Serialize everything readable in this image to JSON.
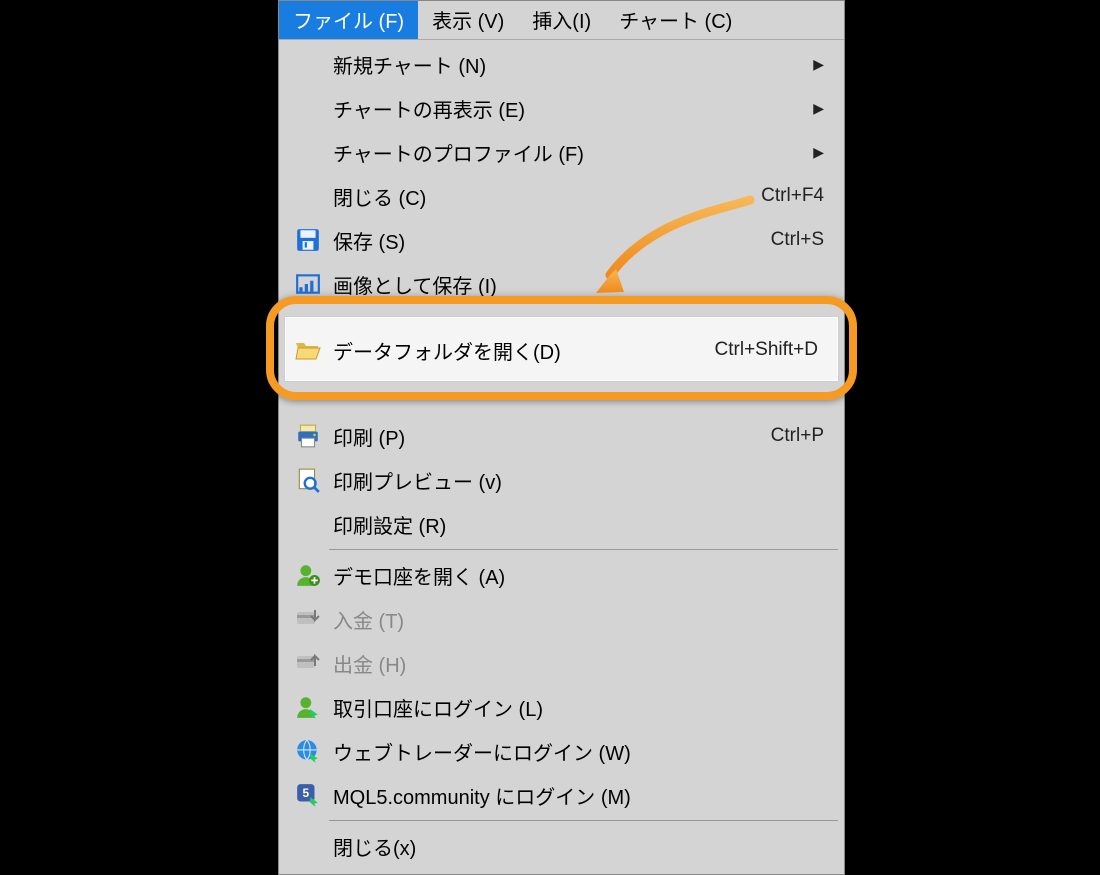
{
  "menubar": {
    "items": [
      {
        "label": "ファイル (F)"
      },
      {
        "label": "表示 (V)"
      },
      {
        "label": "挿入(I)"
      },
      {
        "label": "チャート (C)"
      }
    ]
  },
  "dropdown": {
    "new_chart": {
      "label": "新規チャート (N)"
    },
    "reshow_chart": {
      "label": "チャートの再表示 (E)"
    },
    "chart_profile": {
      "label": "チャートのプロファイル (F)"
    },
    "close": {
      "label": "閉じる (C)",
      "accel": "Ctrl+F4"
    },
    "save": {
      "label": "保存 (S)",
      "accel": "Ctrl+S"
    },
    "save_as_image": {
      "label": "画像として保存 (I)"
    },
    "open_data_folder": {
      "label": "データフォルダを開く(D)",
      "accel": "Ctrl+Shift+D"
    },
    "print": {
      "label": "印刷 (P)",
      "accel": "Ctrl+P"
    },
    "print_preview": {
      "label": "印刷プレビュー (v)"
    },
    "print_settings": {
      "label": "印刷設定 (R)"
    },
    "open_demo": {
      "label": "デモ口座を開く (A)"
    },
    "deposit": {
      "label": "入金 (T)"
    },
    "withdraw": {
      "label": "出金 (H)"
    },
    "login_trade": {
      "label": "取引口座にログイン (L)"
    },
    "login_web": {
      "label": "ウェブトレーダーにログイン (W)"
    },
    "login_mql5": {
      "label": "MQL5.community にログイン (M)"
    },
    "exit": {
      "label": "閉じる(x)"
    }
  }
}
